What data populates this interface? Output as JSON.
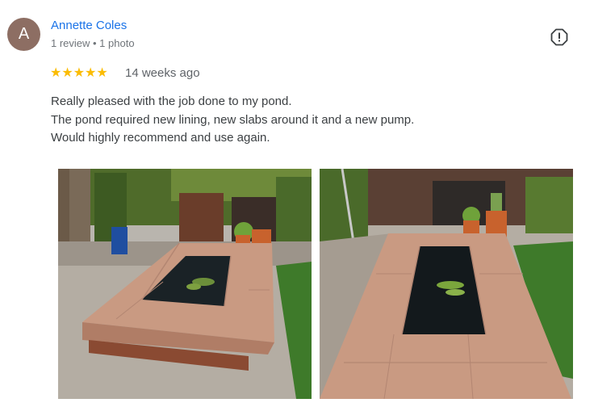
{
  "review": {
    "avatar_letter": "A",
    "author": "Annette Coles",
    "meta": "1 review • 1 photo",
    "rating_stars": "★★★★★",
    "rating": 5,
    "age": "14 weeks ago",
    "text_lines": [
      "Really pleased with the job done to my pond.",
      "The pond required new lining, new slabs around it and a new pump.",
      "Would highly recommend and use again."
    ]
  },
  "icons": {
    "report": "flag-icon"
  },
  "colors": {
    "author_link": "#1a73e8",
    "star": "#fbbc04",
    "avatar_bg": "#8d6e63"
  }
}
